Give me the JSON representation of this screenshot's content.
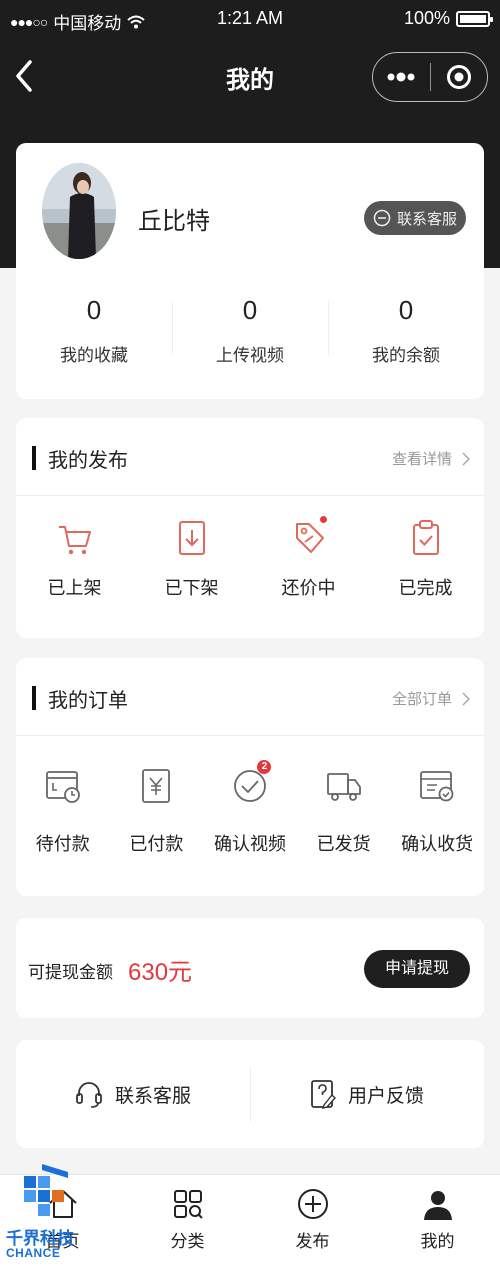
{
  "status_bar": {
    "carrier": "中国移动",
    "time": "1:21 AM",
    "battery": "100%"
  },
  "nav": {
    "title": "我的"
  },
  "profile": {
    "username": "丘比特",
    "contact_label": "联系客服",
    "stats": [
      {
        "value": "0",
        "label": "我的收藏"
      },
      {
        "value": "0",
        "label": "上传视频"
      },
      {
        "value": "0",
        "label": "我的余额"
      }
    ]
  },
  "publish": {
    "title": "我的发布",
    "more": "查看详情",
    "items": [
      {
        "label": "已上架",
        "icon": "cart-icon"
      },
      {
        "label": "已下架",
        "icon": "download-box-icon"
      },
      {
        "label": "还价中",
        "icon": "price-tag-icon"
      },
      {
        "label": "已完成",
        "icon": "clipboard-check-icon"
      }
    ]
  },
  "orders": {
    "title": "我的订单",
    "more": "全部订单",
    "items": [
      {
        "label": "待付款",
        "icon": "wallet-clock-icon"
      },
      {
        "label": "已付款",
        "icon": "yen-receipt-icon"
      },
      {
        "label": "确认视频",
        "icon": "check-circle-icon",
        "badge": "2"
      },
      {
        "label": "已发货",
        "icon": "truck-icon"
      },
      {
        "label": "确认收货",
        "icon": "card-check-icon"
      }
    ]
  },
  "withdraw": {
    "label": "可提现金额",
    "amount": "630元",
    "button": "申请提现"
  },
  "service": [
    {
      "label": "联系客服",
      "icon": "headset-icon"
    },
    {
      "label": "用户反馈",
      "icon": "feedback-icon"
    }
  ],
  "tabbar": [
    {
      "label": "首页",
      "icon": "home-icon"
    },
    {
      "label": "分类",
      "icon": "category-icon"
    },
    {
      "label": "发布",
      "icon": "plus-circle-icon"
    },
    {
      "label": "我的",
      "icon": "user-icon"
    }
  ],
  "watermark": {
    "text": "千界科技",
    "sub": "CHANCE"
  },
  "colors": {
    "accent": "#e4393c",
    "dark": "#1d1d1d"
  }
}
